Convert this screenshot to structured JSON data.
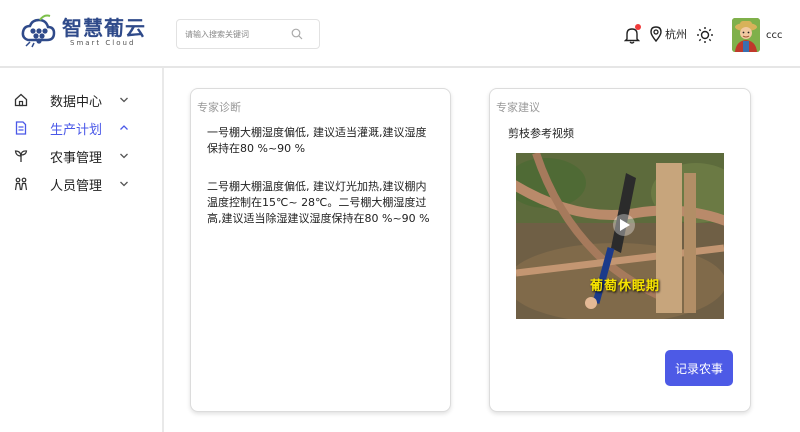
{
  "brand": {
    "name": "智慧葡云",
    "subtitle": "Smart Cloud",
    "accent": "#2f4a8a"
  },
  "search": {
    "placeholder": "请输入搜索关键词"
  },
  "header": {
    "location": "杭州",
    "username": "ccc",
    "icons": [
      "bell-icon",
      "location-pin-icon",
      "sun-icon",
      "avatar"
    ]
  },
  "sidebar": {
    "active_color": "#4a58e8",
    "items": [
      {
        "label": "数据中心",
        "icon": "home-icon",
        "expanded": false,
        "active": false
      },
      {
        "label": "生产计划",
        "icon": "document-icon",
        "expanded": true,
        "active": true
      },
      {
        "label": "农事管理",
        "icon": "sprout-icon",
        "expanded": false,
        "active": false
      },
      {
        "label": "人员管理",
        "icon": "people-icon",
        "expanded": false,
        "active": false
      }
    ]
  },
  "diagnosis": {
    "title": "专家诊断",
    "paragraphs": [
      "一号棚大棚湿度偏低, 建议适当灌溉,建议湿度保持在80 %~90 %",
      "二号棚大棚温度偏低, 建议灯光加热,建议棚内温度控制在15℃~ 28℃。二号棚大棚湿度过高,建议适当除湿建议湿度保持在80 %~90 %"
    ]
  },
  "advice": {
    "title": "专家建议",
    "video_title": "剪枝参考视频",
    "video_caption": "葡萄休眠期",
    "record_button": "记录农事",
    "button_color": "#4d5ae6"
  }
}
